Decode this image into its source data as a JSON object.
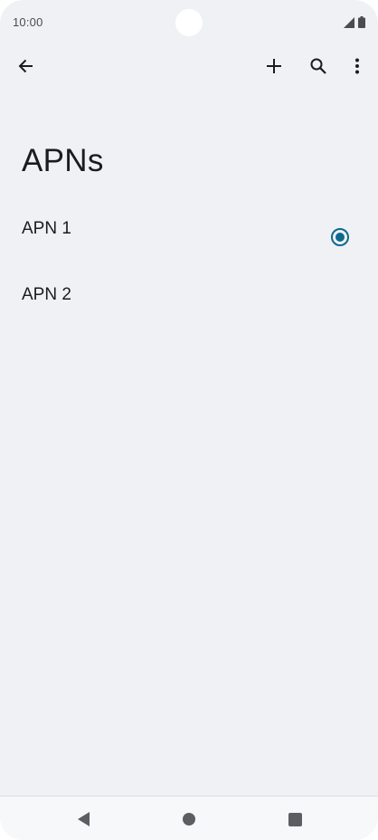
{
  "status_bar": {
    "time": "10:00"
  },
  "toolbar": {
    "back_icon": "arrow-back-icon",
    "add_icon": "plus-icon",
    "search_icon": "search-icon",
    "more_icon": "more-vert-icon"
  },
  "page": {
    "title": "APNs"
  },
  "apns": [
    {
      "name": "APN 1",
      "selected": true
    },
    {
      "name": "APN 2",
      "selected": false
    }
  ],
  "colors": {
    "background": "#eff1f4",
    "accent": "#0c6a8e",
    "text": "#1b1c1e"
  },
  "nav_bar": {
    "back_icon": "nav-back-triangle-icon",
    "home_icon": "nav-home-circle-icon",
    "recents_icon": "nav-recents-square-icon"
  }
}
